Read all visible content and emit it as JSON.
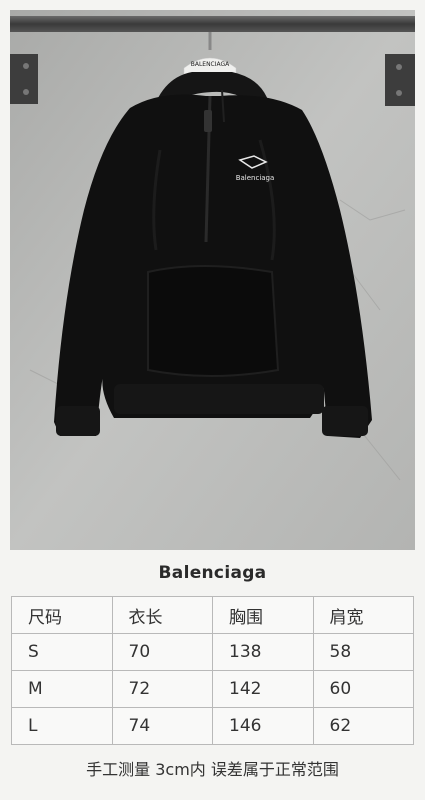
{
  "photo": {
    "hanger_tag": "BALENCIAGA",
    "chest_logo": "Balenciaga"
  },
  "brand": "Balenciaga",
  "size_table": {
    "headers": [
      "尺码",
      "衣长",
      "胸围",
      "肩宽"
    ],
    "rows": [
      [
        "S",
        "70",
        "138",
        "58"
      ],
      [
        "M",
        "72",
        "142",
        "60"
      ],
      [
        "L",
        "74",
        "146",
        "62"
      ]
    ]
  },
  "note": "手工测量 3cm内 误差属于正常范围"
}
